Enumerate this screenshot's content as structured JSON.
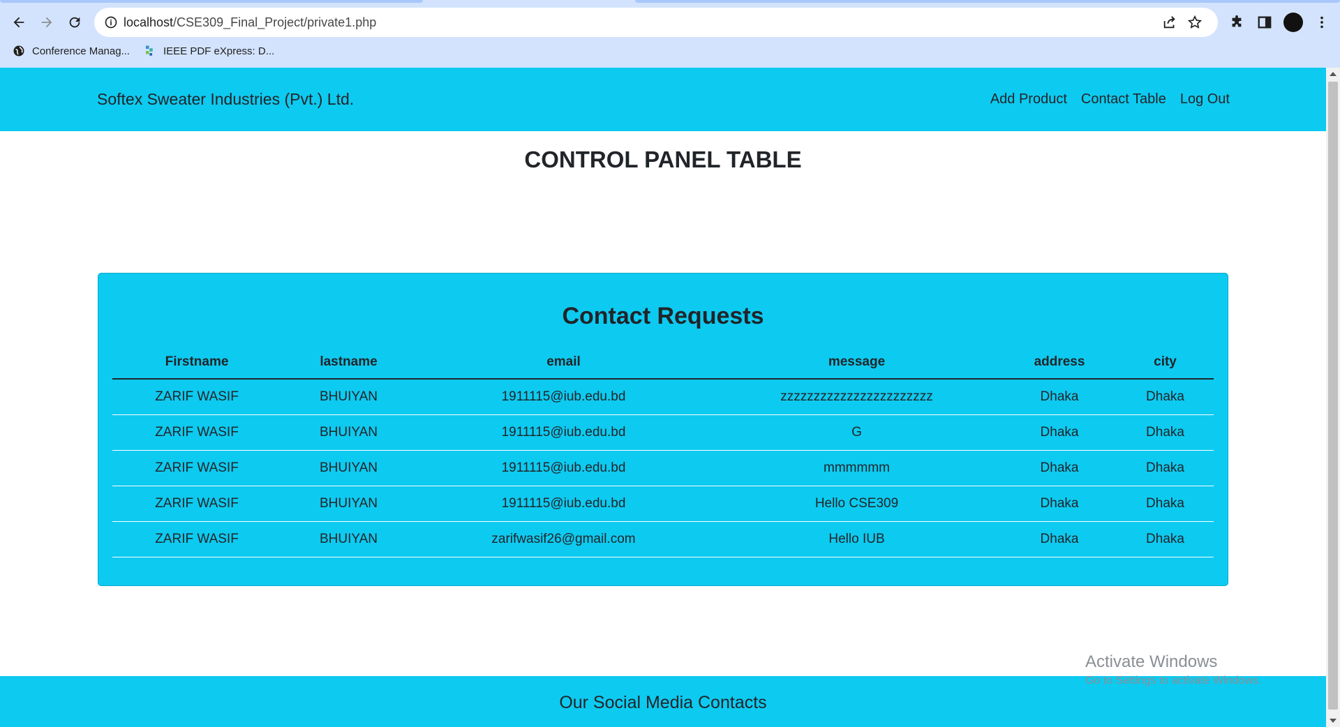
{
  "browser": {
    "url_host": "localhost",
    "url_path": "/CSE309_Final_Project/private1.php",
    "bookmarks": [
      {
        "label": "Conference Manag...",
        "icon": "globe-icon"
      },
      {
        "label": "IEEE PDF eXpress: D...",
        "icon": "ieee-icon"
      }
    ],
    "accent": "#d3e3fd"
  },
  "navbar": {
    "brand": "Softex Sweater Industries (Pvt.) Ltd.",
    "links": [
      "Add Product",
      "Contact Table",
      "Log Out"
    ],
    "background": "#0dcaf0"
  },
  "page": {
    "title": "CONTROL PANEL TABLE"
  },
  "contacts": {
    "title": "Contact Requests",
    "columns": [
      "Firstname",
      "lastname",
      "email",
      "message",
      "address",
      "city"
    ],
    "rows": [
      [
        "ZARIF WASIF",
        "BHUIYAN",
        "1911115@iub.edu.bd",
        "zzzzzzzzzzzzzzzzzzzzzzz",
        "Dhaka",
        "Dhaka"
      ],
      [
        "ZARIF WASIF",
        "BHUIYAN",
        "1911115@iub.edu.bd",
        "G",
        "Dhaka",
        "Dhaka"
      ],
      [
        "ZARIF WASIF",
        "BHUIYAN",
        "1911115@iub.edu.bd",
        "mmmmmm",
        "Dhaka",
        "Dhaka"
      ],
      [
        "ZARIF WASIF",
        "BHUIYAN",
        "1911115@iub.edu.bd",
        "Hello CSE309",
        "Dhaka",
        "Dhaka"
      ],
      [
        "ZARIF WASIF",
        "BHUIYAN",
        "zarifwasif26@gmail.com",
        "Hello IUB",
        "Dhaka",
        "Dhaka"
      ]
    ]
  },
  "footer": {
    "title": "Our Social Media Contacts"
  },
  "watermark": {
    "line1": "Activate Windows",
    "line2": "Go to Settings to activate Windows."
  }
}
